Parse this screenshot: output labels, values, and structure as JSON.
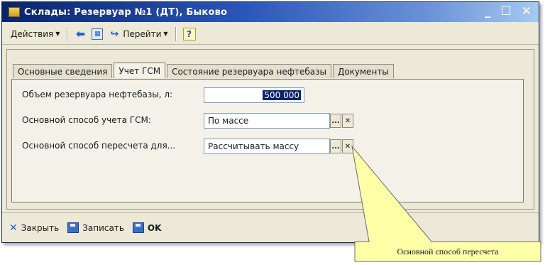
{
  "window": {
    "title": "Склады: Резервуар №1 (ДТ), Быково",
    "controls": {
      "minimize": "_",
      "maximize": "☐",
      "close": "✕"
    }
  },
  "toolbar": {
    "actions_label": "Действия",
    "goto_label": "Перейти",
    "help_label": "?"
  },
  "tabs": [
    {
      "label": "Основные сведения",
      "active": false
    },
    {
      "label": "Учет ГСМ",
      "active": true
    },
    {
      "label": "Состояние резервуара нефтебазы",
      "active": false
    },
    {
      "label": "Документы",
      "active": false
    }
  ],
  "form": {
    "volume_label": "Объем резервуара нефтебазы, л:",
    "volume_value": "500 000",
    "accounting_label": "Основной способ учета ГСМ:",
    "accounting_value": "По массе",
    "recalc_label": "Основной способ пересчета для...",
    "recalc_value": "Рассчитывать массу",
    "choose_btn": "...",
    "clear_btn": "✕"
  },
  "statusbar": {
    "close_label": "Закрыть",
    "save_label": "Записать",
    "ok_label": "OK"
  },
  "callout": {
    "text": "Основной способ пересчета"
  },
  "colors": {
    "title_gradient_start": "#0a246a",
    "title_gradient_end": "#a6caf0",
    "window_bg": "#ece9d8",
    "callout_fill": "#ffffa8",
    "selection_bg": "#0a246a"
  }
}
